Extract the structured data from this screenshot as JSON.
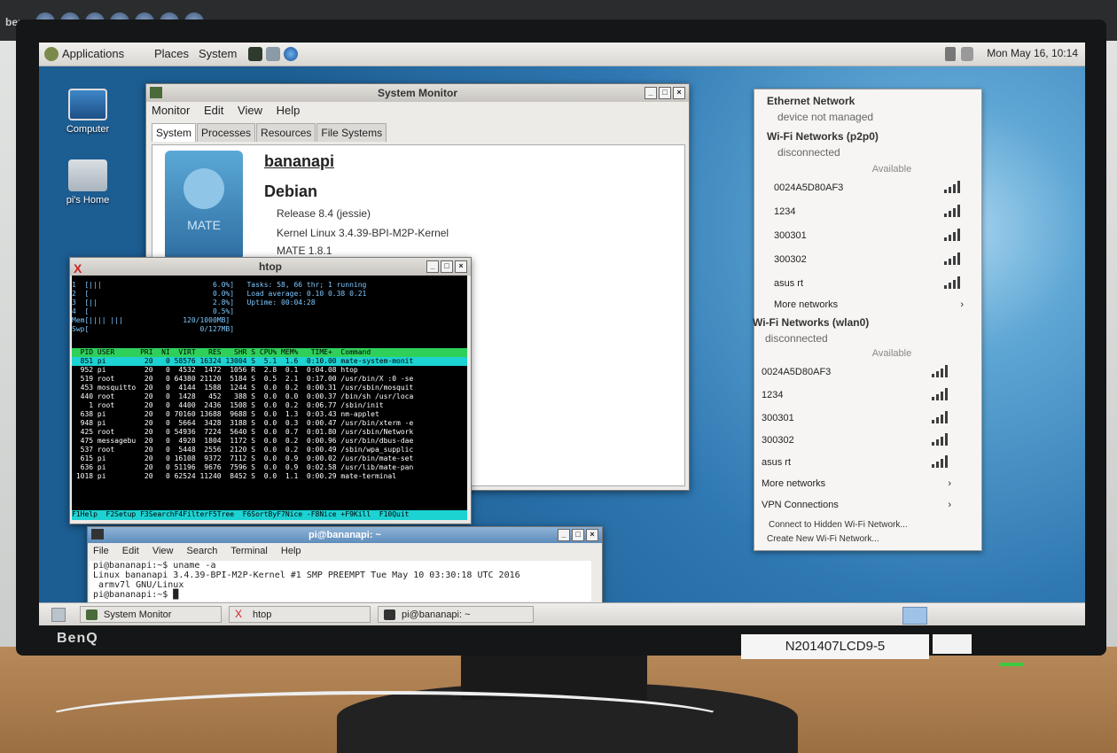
{
  "monitor": {
    "brand_top": "benq",
    "brand_bottom": "BenQ",
    "serial_label": "N201407LCD9-5"
  },
  "top_panel": {
    "menus": [
      "Applications",
      "Places",
      "System"
    ],
    "clock": "Mon May 16, 10:14"
  },
  "desktop_icons": [
    {
      "label": "Computer"
    },
    {
      "label": "pi's Home"
    }
  ],
  "system_monitor": {
    "title": "System Monitor",
    "menus": [
      "Monitor",
      "Edit",
      "View",
      "Help"
    ],
    "tabs": [
      "System",
      "Processes",
      "Resources",
      "File Systems"
    ],
    "active_tab": "System",
    "hostname": "bananapi",
    "os": "Debian",
    "release": "Release 8.4 (jessie)",
    "kernel": "Kernel Linux 3.4.39-BPI-M2P-Kernel",
    "desktop": "MATE 1.8.1",
    "logo_text": "MATE"
  },
  "htop": {
    "title": "htop",
    "meters": [
      "1  [|||                          6.0%]   Tasks: 58, 66 thr; 1 running",
      "2  [                             0.0%]   Load average: 0.10 0.38 0.21",
      "3  [||                           2.8%]   Uptime: 00:04:28",
      "4  [                             0.5%]",
      "Mem[|||| |||              120/1000MB]",
      "Swp[                          0/127MB]"
    ],
    "header": "  PID USER      PRI  NI  VIRT   RES   SHR S CPU% MEM%   TIME+  Command",
    "rows": [
      "  851 pi         20   0 58576 16324 13004 S  5.1  1.6  0:10.00 mate-system-monit",
      "  952 pi         20   0  4532  1472  1056 R  2.8  0.1  0:04.08 htop",
      "  519 root       20   0 64380 21120  5184 S  0.5  2.1  0:17.00 /usr/bin/X :0 -se",
      "  453 mosquitto  20   0  4144  1588  1244 S  0.0  0.2  0:00.31 /usr/sbin/mosquit",
      "  440 root       20   0  1428   452   388 S  0.0  0.0  0:00.37 /bin/sh /usr/loca",
      "    1 root       20   0  4400  2436  1508 S  0.0  0.2  0:06.77 /sbin/init",
      "  638 pi         20   0 70160 13688  9688 S  0.0  1.3  0:03.43 nm-applet",
      "  948 pi         20   0  5664  3428  3188 S  0.0  0.3  0:00.47 /usr/bin/xterm -e",
      "  425 root       20   0 54936  7224  5640 S  0.0  0.7  0:01.80 /usr/sbin/Network",
      "  475 messagebu  20   0  4928  1804  1172 S  0.0  0.2  0:00.96 /usr/bin/dbus-dae",
      "  537 root       20   0  5448  2556  2120 S  0.0  0.2  0:00.49 /sbin/wpa_supplic",
      "  615 pi         20   0 16108  9372  7112 S  0.0  0.9  0:00.02 /usr/bin/mate-set",
      "  636 pi         20   0 51196  9676  7596 S  0.0  0.9  0:02.58 /usr/lib/mate-pan",
      " 1018 pi         20   0 62524 11240  8452 S  0.0  1.1  0:00.29 mate-terminal"
    ],
    "function_keys": "F1Help  F2Setup F3SearchF4FilterF5Tree  F6SortByF7Nice -F8Nice +F9Kill  F10Quit"
  },
  "terminal": {
    "title": "pi@bananapi: ~",
    "menus": [
      "File",
      "Edit",
      "View",
      "Search",
      "Terminal",
      "Help"
    ],
    "lines": [
      "pi@bananapi:~$ uname -a",
      "Linux bananapi 3.4.39-BPI-M2P-Kernel #1 SMP PREEMPT Tue May 10 03:30:18 UTC 2016",
      " armv7l GNU/Linux",
      "pi@bananapi:~$ █"
    ]
  },
  "network_menu": {
    "ethernet_title": "Ethernet Network",
    "ethernet_status": "device not managed",
    "wifi1_title": "Wi-Fi Networks (p2p0)",
    "wifi1_status": "disconnected",
    "available_label": "Available",
    "wifi1_networks": [
      "0024A5D80AF3",
      "1234",
      "300301",
      "300302",
      "asus rt"
    ],
    "more_networks": "More networks",
    "wifi2_title": "Wi-Fi Networks (wlan0)",
    "wifi2_status": "disconnected",
    "wifi2_networks": [
      "0024A5D80AF3",
      "1234",
      "300301",
      "300302",
      "asus rt"
    ],
    "vpn": "VPN Connections",
    "connect_hidden": "Connect to Hidden Wi-Fi Network...",
    "create_new": "Create New Wi-Fi Network..."
  },
  "taskbar": [
    {
      "label": "System Monitor"
    },
    {
      "label": "htop"
    },
    {
      "label": "pi@bananapi: ~"
    }
  ]
}
